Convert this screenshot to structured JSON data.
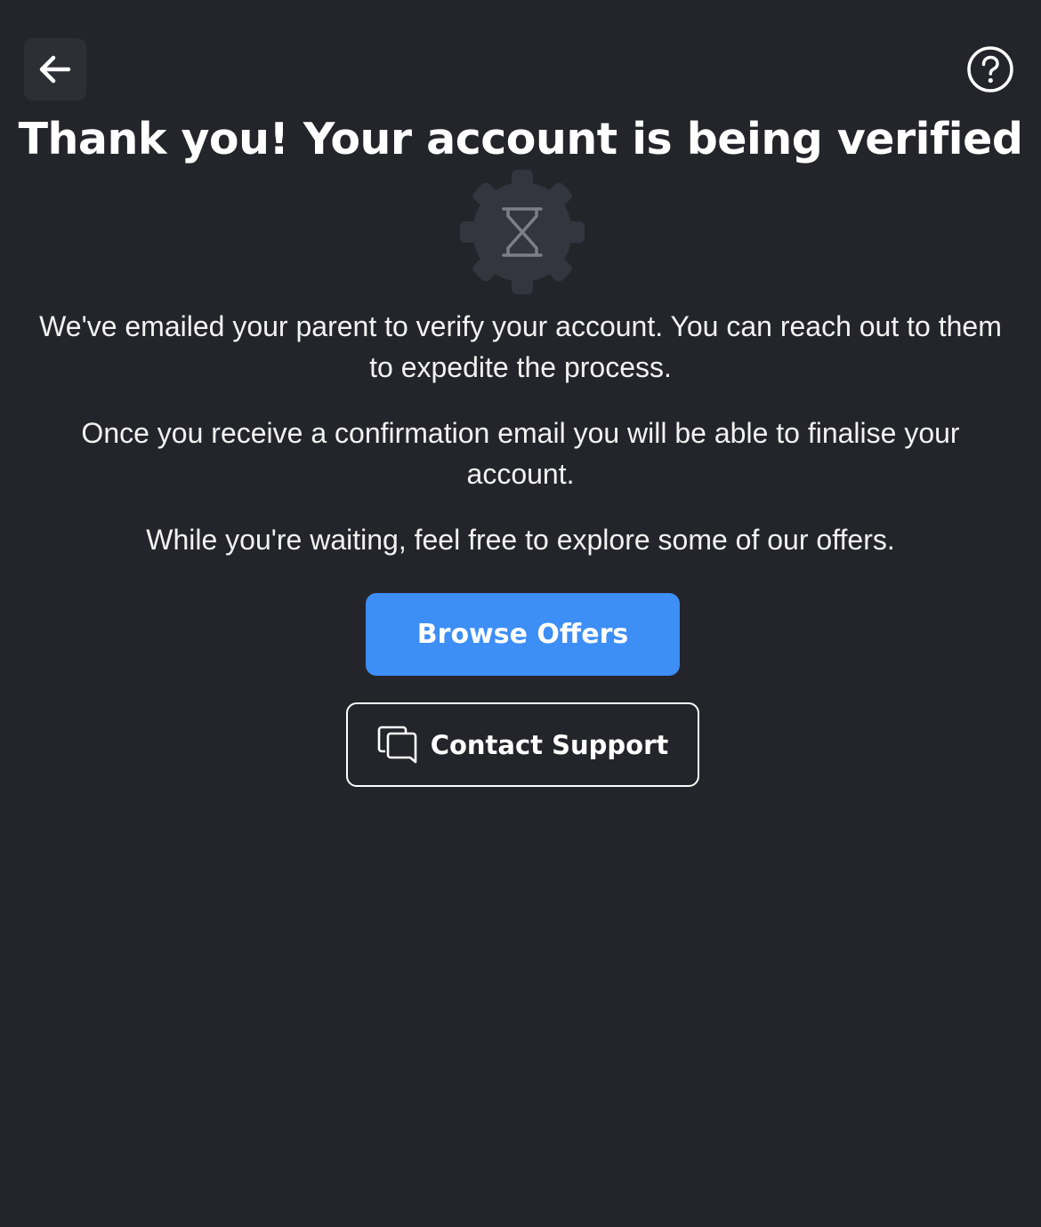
{
  "header": {
    "back_icon": "arrow-left-icon",
    "help_icon": "question-circle-icon"
  },
  "title": "Thank you! Your account is being verified",
  "status_icon": "hourglass-gear-icon",
  "messages": [
    "We've emailed your parent to verify your account. You can reach out to them to expedite the process.",
    "Once you receive a confirmation email you will be able to finalise your account.",
    "While you're waiting, feel free to explore some of our offers."
  ],
  "actions": {
    "browse_label": "Browse Offers",
    "support_label": "Contact Support",
    "support_icon": "chat-bubbles-icon"
  },
  "colors": {
    "background": "#24252a",
    "primary": "#3d8ef5",
    "text": "#ffffff"
  }
}
